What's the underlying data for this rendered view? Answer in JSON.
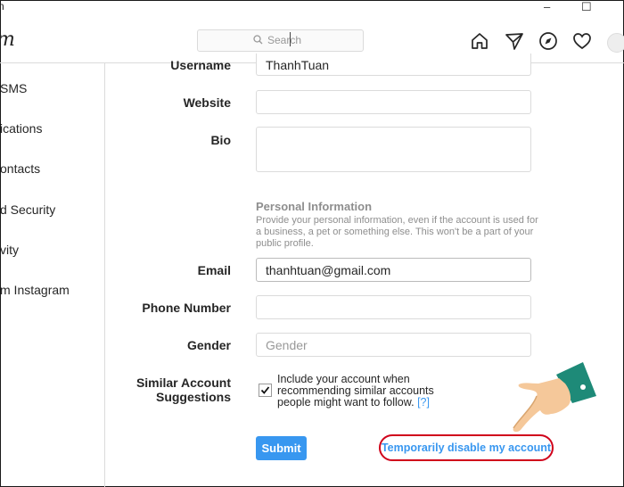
{
  "window": {
    "title_partial": "n",
    "minimize_label": "–",
    "maximize_label": "☐"
  },
  "header": {
    "logo_partial": "m",
    "search_placeholder": "Search"
  },
  "sidebar": {
    "items": [
      {
        "label": "SMS"
      },
      {
        "label": "ications"
      },
      {
        "label": "ontacts"
      },
      {
        "label": "d Security"
      },
      {
        "label": "vity"
      },
      {
        "label": "m Instagram"
      }
    ]
  },
  "form": {
    "username": {
      "label": "Username",
      "value": "ThanhTuan"
    },
    "website": {
      "label": "Website",
      "value": ""
    },
    "bio": {
      "label": "Bio",
      "value": ""
    },
    "personal_info": {
      "title": "Personal Information",
      "description": "Provide your personal information, even if the account is used for a business, a pet or something else. This won't be a part of your public profile."
    },
    "email": {
      "label": "Email",
      "value": "thanhtuan@gmail.com"
    },
    "phone": {
      "label": "Phone Number",
      "value": ""
    },
    "gender": {
      "label": "Gender",
      "placeholder": "Gender"
    },
    "similar": {
      "label_line1": "Similar Account",
      "label_line2": "Suggestions",
      "checked": true,
      "text": "Include your account when recommending similar accounts people might want to follow.",
      "help": "[?]"
    },
    "submit_label": "Submit",
    "disable_label": "Temporarily disable my account"
  },
  "colors": {
    "accent": "#3897f0",
    "highlight": "#d0021b"
  }
}
